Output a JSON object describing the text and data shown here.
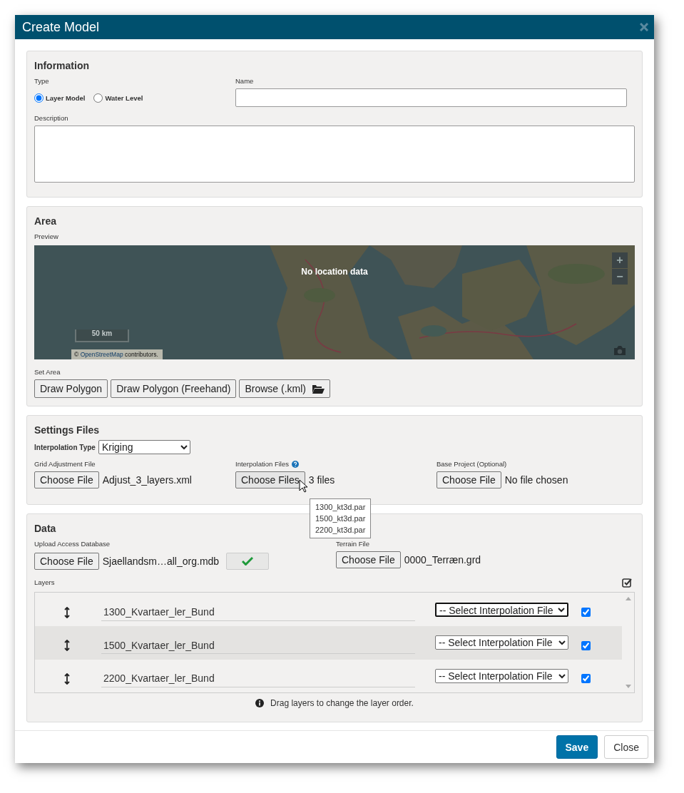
{
  "dialog": {
    "title": "Create Model"
  },
  "information": {
    "heading": "Information",
    "type_label": "Type",
    "types": [
      {
        "label": "Layer Model",
        "selected": true
      },
      {
        "label": "Water Level",
        "selected": false
      }
    ],
    "name_label": "Name",
    "description_label": "Description"
  },
  "area": {
    "heading": "Area",
    "preview_label": "Preview",
    "map": {
      "kind": "picture",
      "overlay": "No location data",
      "zoom_in": "+",
      "zoom_out": "−",
      "scale": "50 km",
      "attribution": {
        "prefix": "©",
        "link": "OpenStreetMap",
        "suffix": "contributors."
      }
    },
    "set_area_label": "Set Area",
    "buttons": [
      {
        "label": "Draw Polygon",
        "icon": false
      },
      {
        "label": "Draw Polygon (Freehand)",
        "icon": false
      },
      {
        "label": "Browse (.kml)",
        "icon": true
      }
    ]
  },
  "settings": {
    "heading": "Settings Files",
    "interpolation_type": {
      "label": "Interpolation Type",
      "value": "Kriging"
    },
    "files": [
      {
        "label": "Grid Adjustment File",
        "kind": "plain",
        "button": "Choose File",
        "status": "Adjust_3_layers.xml",
        "hovered": false
      },
      {
        "label": "Interpolation Files",
        "kind": "help",
        "button": "Choose Files",
        "status": "3 files",
        "hovered": true
      },
      {
        "label": "Base Project (Optional)",
        "kind": "plain",
        "button": "Choose File",
        "status": "No file chosen",
        "hovered": false
      }
    ],
    "tooltip": [
      "1300_kt3d.par",
      "1500_kt3d.par",
      "2200_kt3d.par"
    ]
  },
  "data": {
    "heading": "Data",
    "access_db": {
      "label": "Upload Access Database",
      "button": "Choose File",
      "status": "Sjaellandsm…all_org.mdb"
    },
    "terrain": {
      "label": "Terrain File",
      "button": "Choose File",
      "status": "0000_Terræn.grd"
    },
    "layers_label": "Layers",
    "layers": [
      {
        "name": "1300_Kvartaer_ler_Bund",
        "select": "-- Select Interpolation File",
        "focused": true,
        "highlighted": false,
        "checked": true
      },
      {
        "name": "1500_Kvartaer_ler_Bund",
        "select": "-- Select Interpolation File",
        "focused": false,
        "highlighted": true,
        "checked": true
      },
      {
        "name": "2200_Kvartaer_ler_Bund",
        "select": "-- Select Interpolation File",
        "focused": false,
        "highlighted": false,
        "checked": true
      }
    ],
    "hint": "Drag layers to change the layer order."
  },
  "footer": {
    "buttons": [
      {
        "label": "Save",
        "kind": "primary"
      },
      {
        "label": "Close",
        "kind": "default"
      }
    ]
  }
}
